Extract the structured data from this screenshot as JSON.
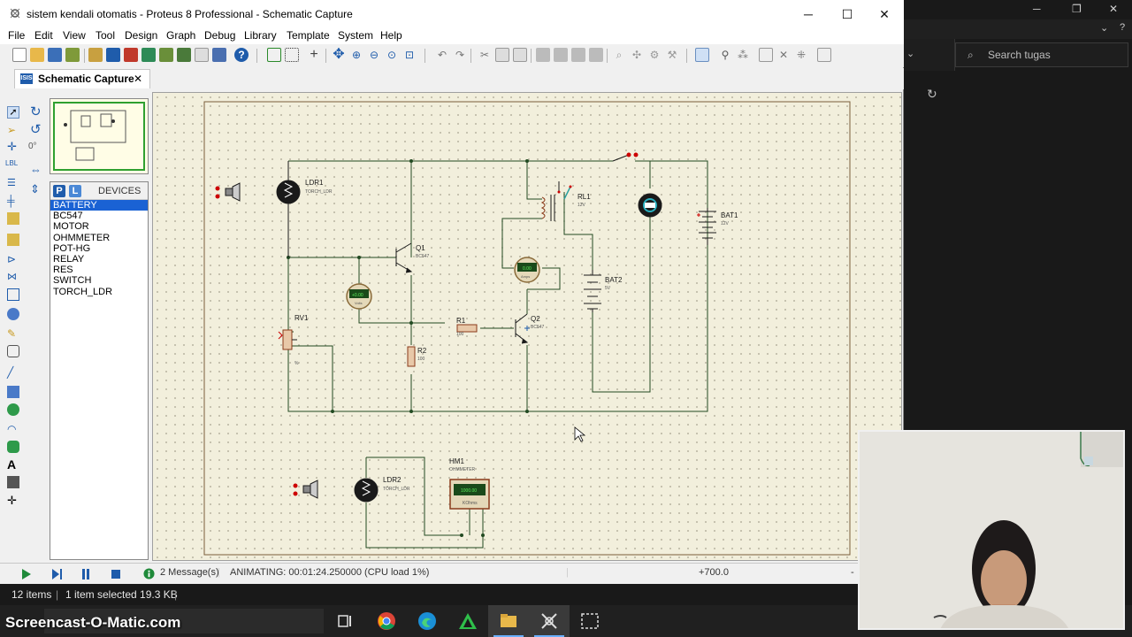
{
  "window": {
    "title": "sistem kendali otomatis - Proteus 8 Professional - Schematic Capture",
    "minimize": "─",
    "maximize": "☐",
    "close": "✕"
  },
  "menu": [
    "File",
    "Edit",
    "View",
    "Tool",
    "Design",
    "Graph",
    "Debug",
    "Library",
    "Template",
    "System",
    "Help"
  ],
  "tab": {
    "label": "Schematic Capture",
    "close": "✕"
  },
  "devices": {
    "header": "DEVICES",
    "p_button": "P",
    "l_button": "L",
    "items": [
      "BATTERY",
      "BC547",
      "MOTOR",
      "OHMMETER",
      "POT-HG",
      "RELAY",
      "RES",
      "SWITCH",
      "TORCH_LDR"
    ],
    "selected": "BATTERY"
  },
  "rotation": "0°",
  "schematic": {
    "ldr1": {
      "name": "LDR1",
      "type": "TORCH_LDR"
    },
    "ldr2": {
      "name": "LDR2",
      "type": "TORCH_LDR"
    },
    "q1": {
      "name": "Q1",
      "type": "BC547"
    },
    "q2": {
      "name": "Q2",
      "type": "BC547"
    },
    "rv1": {
      "name": "RV1",
      "value": "%"
    },
    "r1": {
      "name": "R1",
      "value": "100"
    },
    "r2": {
      "name": "R2",
      "value": "100"
    },
    "rl1": {
      "name": "RL1",
      "value": "12V"
    },
    "bat1": {
      "name": "BAT1",
      "value": "12V"
    },
    "bat2": {
      "name": "BAT2",
      "value": "5V"
    },
    "hm1": {
      "name": "HM1",
      "type": "OHMMETER",
      "reading": "1000.00",
      "unit": "KOhms"
    },
    "voltmeter": {
      "reading": "+0.00",
      "unit": "Volts"
    },
    "ammeter": {
      "reading": "0.00",
      "unit": "Amps"
    }
  },
  "status": {
    "messages": "2 Message(s)",
    "animating": "ANIMATING: 00:01:24.250000 (CPU load 1%)",
    "coord": "+700.0",
    "coord2": "-"
  },
  "explorer": {
    "search_placeholder": "Search tugas",
    "items_count": "12 items",
    "selected_info": "1 item selected  19.3 KB"
  },
  "watermark": "Screencast-O-Matic.com",
  "colors": {
    "accent": "#1a62d4",
    "wire": "#1f5c1f",
    "canvas": "#f2efdc"
  }
}
